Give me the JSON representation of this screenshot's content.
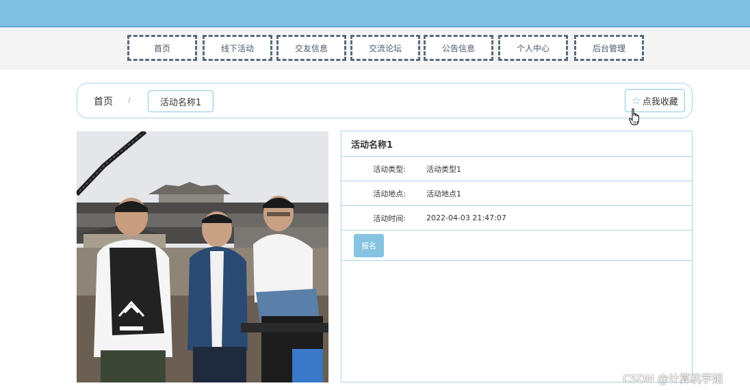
{
  "nav": {
    "items": [
      "首页",
      "线下活动",
      "交友信息",
      "交流论坛",
      "公告信息",
      "个人中心",
      "后台管理"
    ]
  },
  "breadcrumb": {
    "home": "首页",
    "separator": "/",
    "current": "活动名称1"
  },
  "favorite": {
    "label": "点我收藏",
    "icon": "star-outline-icon"
  },
  "detail": {
    "title": "活动名称1",
    "fields": [
      {
        "label": "活动类型:",
        "value": "活动类型1"
      },
      {
        "label": "活动地点:",
        "value": "活动地点1"
      },
      {
        "label": "活动时间:",
        "value": "2022-04-03 21:47:07"
      }
    ],
    "signup_label": "报名"
  },
  "watermark": "CSDN @计算机学姐",
  "colors": {
    "topbar": "#7fc1e3",
    "accent_border": "#a9d2e3",
    "button": "#86c3e1",
    "nav_border": "#5a6a7c"
  }
}
